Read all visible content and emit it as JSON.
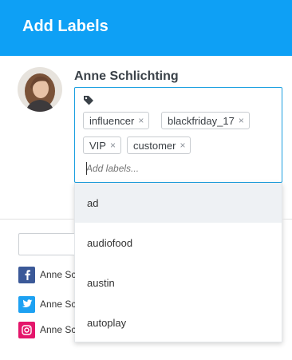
{
  "dialog": {
    "title": "Add Labels"
  },
  "contact": {
    "name": "Anne Schlichting"
  },
  "labels": {
    "tags": [
      {
        "text": "influencer",
        "remove": "×"
      },
      {
        "text": "blackfriday_17",
        "remove": "×"
      },
      {
        "text": "VIP",
        "remove": "×"
      },
      {
        "text": "customer",
        "remove": "×"
      }
    ],
    "input_placeholder": "Add labels...",
    "suggestions": [
      "ad",
      "audiofood",
      "austin",
      "autoplay"
    ]
  },
  "accounts": [
    {
      "network": "facebook",
      "name": "Anne Sc",
      "color": "#3b5998",
      "icon": "facebook-icon"
    },
    {
      "network": "twitter",
      "name": "Anne Sc",
      "color": "#1da1f2",
      "icon": "twitter-icon"
    },
    {
      "network": "instagram",
      "name": "Anne Sc",
      "color": "#e4166b",
      "icon": "instagram-icon"
    }
  ],
  "colors": {
    "header": "#0ea0f5",
    "focus_border": "#1a9fe0",
    "active_item": "#eef1f4"
  }
}
